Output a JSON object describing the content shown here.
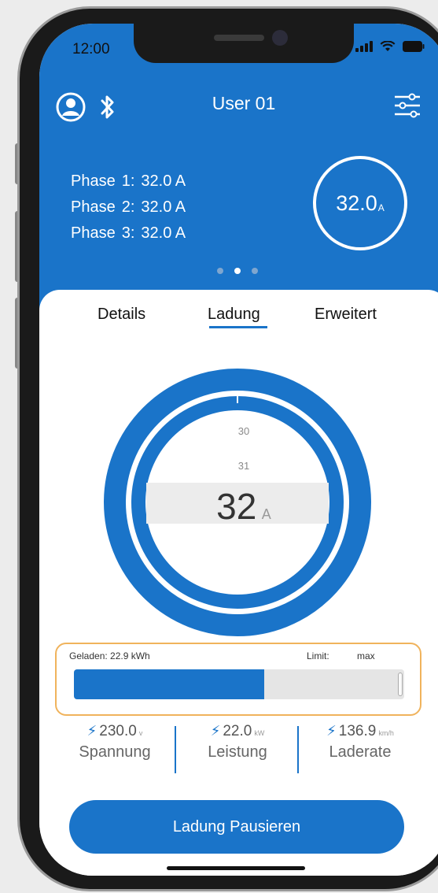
{
  "status_bar": {
    "time": "12:00"
  },
  "header": {
    "user_name": "User 01",
    "phases": [
      {
        "label": "Phase",
        "number": "1:",
        "value": "32.0 A"
      },
      {
        "label": "Phase",
        "number": "2:",
        "value": "32.0 A"
      },
      {
        "label": "Phase",
        "number": "3:",
        "value": "32.0 A"
      }
    ],
    "current": {
      "value": "32.0",
      "unit": "A"
    },
    "pager": {
      "count": 3,
      "active_index": 1
    }
  },
  "tabs": [
    {
      "label": "Details"
    },
    {
      "label": "Ladung",
      "active": true
    },
    {
      "label": "Erweitert"
    }
  ],
  "dial": {
    "above_2": "30",
    "above_1": "31",
    "selected": "32",
    "unit": "A"
  },
  "charge": {
    "charged_label": "Geladen: 22.9 kWh",
    "limit_label": "Limit:",
    "limit_value": "max",
    "progress": 0.575
  },
  "stats": [
    {
      "value": "230.0",
      "unit": "v",
      "name": "Spannung"
    },
    {
      "value": "22.0",
      "unit": "kW",
      "name": "Leistung"
    },
    {
      "value": "136.9",
      "unit": "km/h",
      "name": "Laderate"
    }
  ],
  "action": {
    "label": "Ladung Pausieren"
  },
  "colors": {
    "primary": "#1a74c9",
    "highlight_border": "#f0b35c",
    "background": "#ececec"
  },
  "icons": {
    "profile": "user-circle-icon",
    "bluetooth": "bluetooth-icon",
    "settings": "sliders-icon",
    "bolt": "lightning-bolt-icon"
  }
}
